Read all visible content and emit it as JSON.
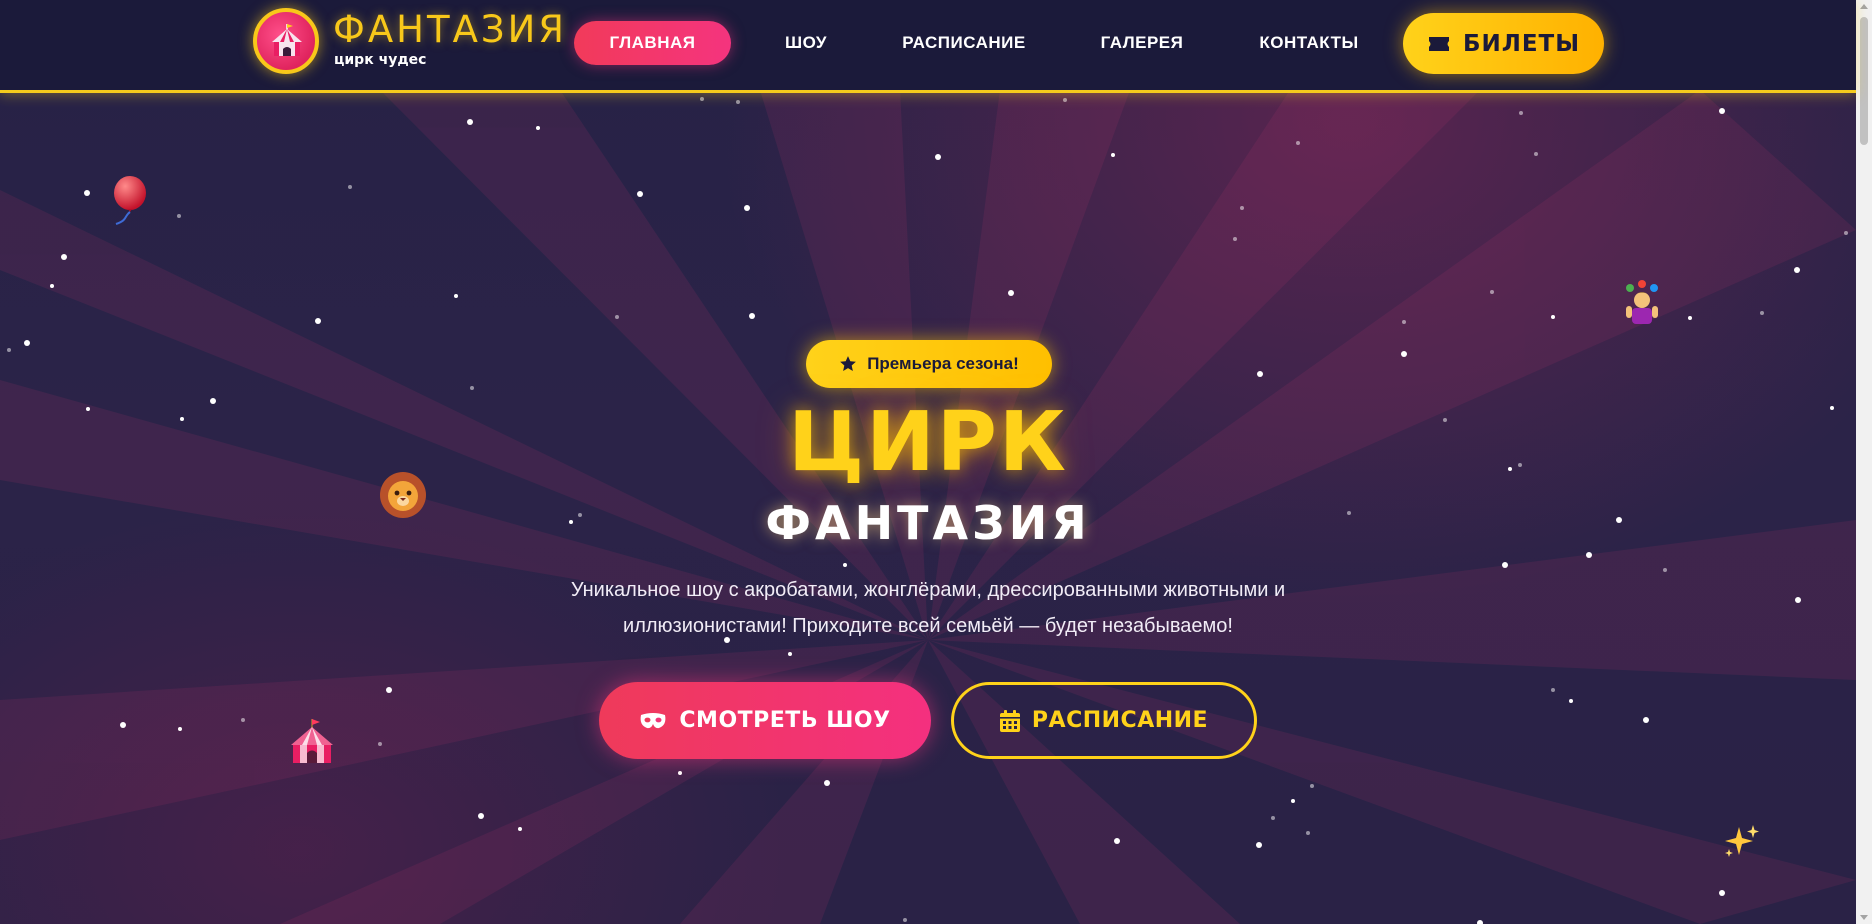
{
  "header": {
    "brand_name": "ФАНТАЗИЯ",
    "brand_tagline": "цирк чудес",
    "nav_items": [
      {
        "label": "ГЛАВНАЯ",
        "active": true
      },
      {
        "label": "ШОУ",
        "active": false
      },
      {
        "label": "РАСПИСАНИЕ",
        "active": false
      },
      {
        "label": "ГАЛЕРЕЯ",
        "active": false
      },
      {
        "label": "КОНТАКТЫ",
        "active": false
      }
    ],
    "tickets_label": "БИЛЕТЫ",
    "tickets_icon": "ticket-icon"
  },
  "hero": {
    "badge_label": "Премьера сезона!",
    "badge_icon": "star-icon",
    "title": "ЦИРК",
    "subtitle": "ФАНТАЗИЯ",
    "description_line1": "Уникальное шоу с акробатами, жонглёрами, дрессированными животными и",
    "description_line2": "иллюзионистами! Приходите всей семьёй — будет незабываемо!",
    "primary_button_label": "СМОТРЕТЬ ШОУ",
    "primary_button_icon": "mask-icon",
    "secondary_button_label": "РАСПИСАНИЕ",
    "secondary_button_icon": "calendar-icon",
    "floating_decorations": [
      "balloon-icon",
      "lion-icon",
      "circus-tent-icon",
      "juggler-icon",
      "sparkles-icon"
    ]
  },
  "colors": {
    "accent_yellow": "#ffd21a",
    "accent_pink": "#f4307f",
    "header_bg": "#1b1a3a",
    "hero_bg": "#2a2348"
  }
}
